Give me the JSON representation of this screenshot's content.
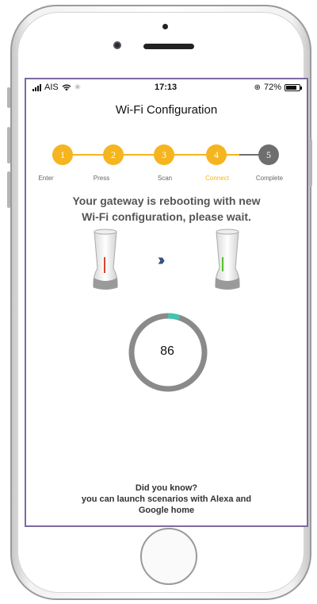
{
  "status_bar": {
    "carrier": "AIS",
    "time": "17:13",
    "battery_percent": "72%",
    "battery_level": 0.72
  },
  "screen": {
    "title": "Wi-Fi Configuration"
  },
  "stepper": {
    "steps": [
      {
        "number": "1",
        "label": "Enter",
        "state": "done"
      },
      {
        "number": "2",
        "label": "Press",
        "state": "done"
      },
      {
        "number": "3",
        "label": "Scan",
        "state": "done"
      },
      {
        "number": "4",
        "label": "Connect",
        "state": "current"
      },
      {
        "number": "5",
        "label": "Complete",
        "state": "pending"
      }
    ],
    "colors": {
      "active": "#f5b51f",
      "pending": "#6e6e6e",
      "active_label": "#f5b51f",
      "label": "#6e6e6e"
    }
  },
  "message": {
    "line1": "Your gateway is rebooting with new",
    "line2": "Wi-Fi configuration, please wait."
  },
  "transition": {
    "from_light": "red",
    "to_light": "green",
    "arrow_icon": "double-chevron-right-icon"
  },
  "progress": {
    "value": "86",
    "fill_fraction": 0.05,
    "colors": {
      "track": "#8a8a8a",
      "fill": "#49c1b0"
    }
  },
  "tip": {
    "line1": "Did you know?",
    "line2": "you can launch scenarios with Alexa and",
    "line3": "Google home"
  }
}
